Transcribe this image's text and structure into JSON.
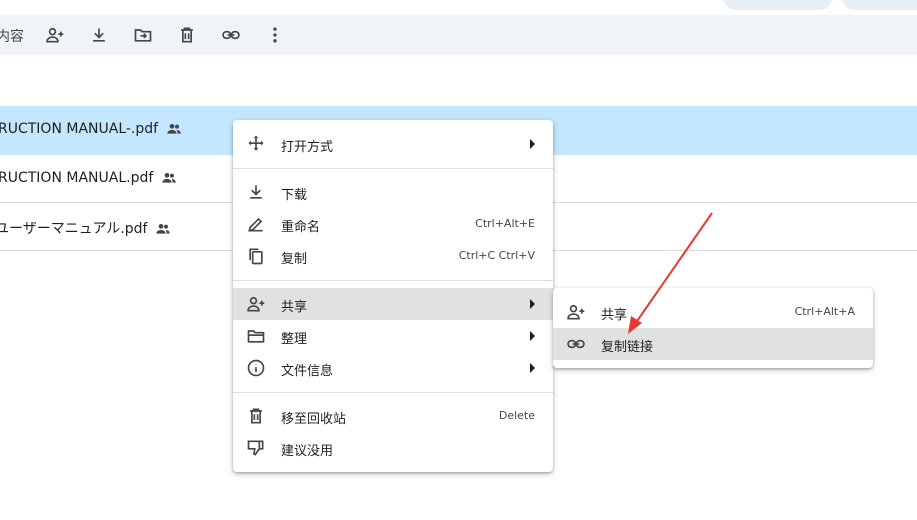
{
  "toolbar": {
    "partial_label": "内容",
    "icons": [
      "add-person-icon",
      "download-icon",
      "move-to-folder-icon",
      "trash-icon",
      "link-icon",
      "more-vert-icon"
    ]
  },
  "files": [
    {
      "name": "RUCTION MANUAL-.pdf",
      "shared": true,
      "selected": true
    },
    {
      "name": "RUCTION MANUAL.pdf",
      "shared": true,
      "selected": false
    },
    {
      "name": "ユーザーマニュアル.pdf",
      "shared": true,
      "selected": false
    }
  ],
  "context_menu": {
    "open_with": "打开方式",
    "download": "下载",
    "rename": "重命名",
    "rename_shortcut": "Ctrl+Alt+E",
    "copy": "复制",
    "copy_shortcut": "Ctrl+C Ctrl+V",
    "share": "共享",
    "organize": "整理",
    "file_info": "文件信息",
    "trash": "移至回收站",
    "trash_shortcut": "Delete",
    "suggest": "建议没用"
  },
  "share_submenu": {
    "share": "共享",
    "share_shortcut": "Ctrl+Alt+A",
    "copy_link": "复制链接"
  },
  "colors": {
    "selected_row": "#c2e7ff",
    "toolbar_bg": "#f0f4f9",
    "annotation_arrow": "#e53935"
  }
}
